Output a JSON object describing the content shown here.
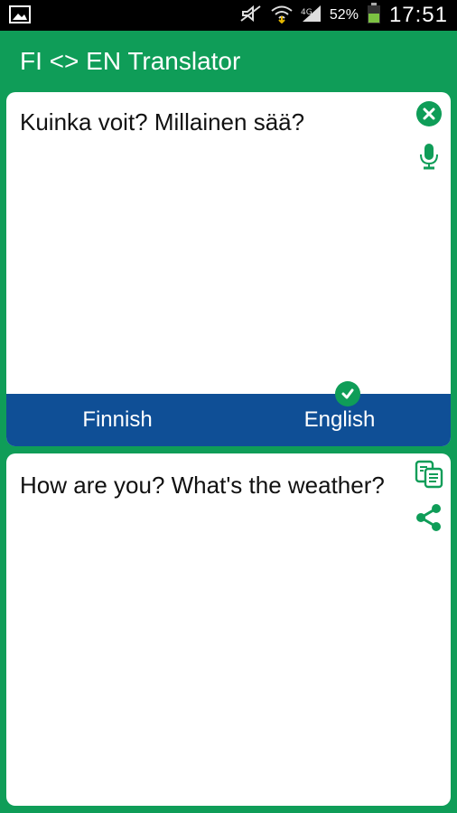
{
  "status_bar": {
    "battery_percent": "52%",
    "time": "17:51"
  },
  "app": {
    "title": "FI <> EN Translator"
  },
  "input_panel": {
    "text": "Kuinka voit? Millainen sää?",
    "clear_icon": "close-circle-icon",
    "mic_icon": "microphone-icon"
  },
  "language_bar": {
    "source_language": "Finnish",
    "target_language": "English",
    "selected": "English"
  },
  "output_panel": {
    "text": "How are you? What's the weather?",
    "copy_icon": "copy-icon",
    "share_icon": "share-icon"
  },
  "colors": {
    "primary_green": "#0f9d58",
    "language_bar_blue": "#0f4f96",
    "status_bar_black": "#000000",
    "card_white": "#ffffff",
    "text": "#111111"
  }
}
